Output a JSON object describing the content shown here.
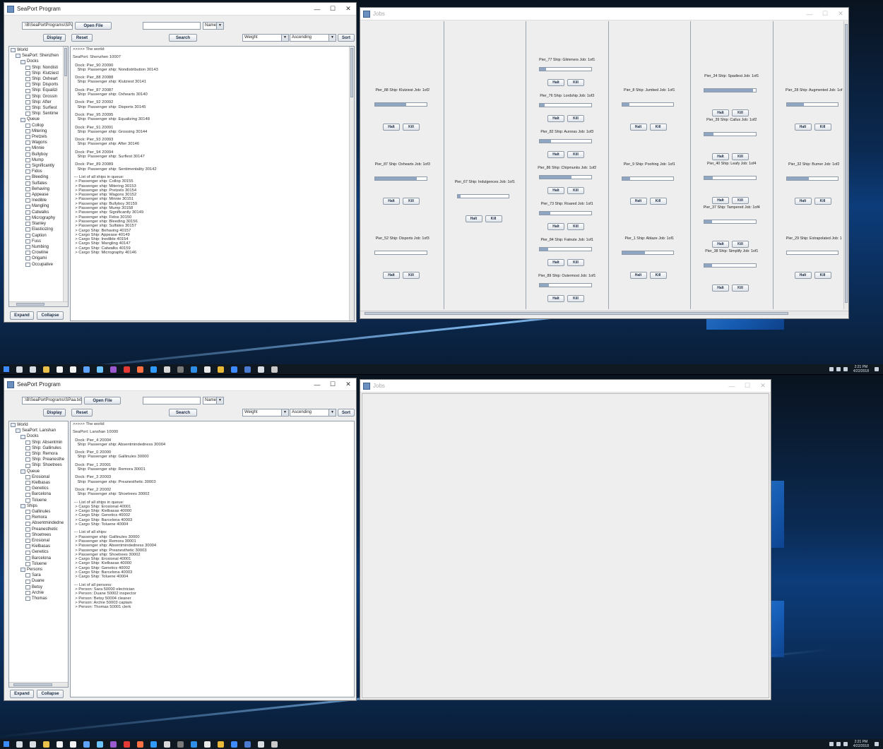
{
  "app": {
    "title": "SeaPort Program",
    "file_path": ":\\B\\SeaPortPrograms\\SPaa.txt",
    "open_file_label": "Open File",
    "search_value": "",
    "search_type": "Name",
    "display_label": "Display",
    "reset_label": "Reset",
    "search_label": "Search",
    "sort_field": "Weight",
    "sort_order": "Ascending",
    "sort_label": "Sort",
    "expand_label": "Expand",
    "collapse_label": "Collapse"
  },
  "jobs_window": {
    "title": "Jobs"
  },
  "window_buttons": {
    "minimize": "—",
    "maximize": "☐",
    "close": "✕"
  },
  "top": {
    "tree": [
      {
        "text": "World",
        "indent": 0,
        "folder": true
      },
      {
        "text": "SeaPort: Shenzhen",
        "indent": 1,
        "folder": true
      },
      {
        "text": "Docks",
        "indent": 2,
        "folder": true
      },
      {
        "text": "Ship: Nondisti",
        "indent": 3,
        "folder": false
      },
      {
        "text": "Ship: Klutziest",
        "indent": 3,
        "folder": false
      },
      {
        "text": "Ship: Oxheart",
        "indent": 3,
        "folder": false
      },
      {
        "text": "Ship: Disports",
        "indent": 3,
        "folder": false
      },
      {
        "text": "Ship: Equalizi",
        "indent": 3,
        "folder": false
      },
      {
        "text": "Ship: Grossin",
        "indent": 3,
        "folder": false
      },
      {
        "text": "Ship: After",
        "indent": 3,
        "folder": false
      },
      {
        "text": "Ship: Surfiest",
        "indent": 3,
        "folder": false
      },
      {
        "text": "Ship: Sentime",
        "indent": 3,
        "folder": false
      },
      {
        "text": "Queue",
        "indent": 2,
        "folder": true
      },
      {
        "text": "Collop",
        "indent": 3,
        "folder": false
      },
      {
        "text": "Mitering",
        "indent": 3,
        "folder": false
      },
      {
        "text": "Pretzels",
        "indent": 3,
        "folder": false
      },
      {
        "text": "Wagons",
        "indent": 3,
        "folder": false
      },
      {
        "text": "Minnie",
        "indent": 3,
        "folder": false
      },
      {
        "text": "Bullyboy",
        "indent": 3,
        "folder": false
      },
      {
        "text": "Mump",
        "indent": 3,
        "folder": false
      },
      {
        "text": "Significantly",
        "indent": 3,
        "folder": false
      },
      {
        "text": "Fidos",
        "indent": 3,
        "folder": false
      },
      {
        "text": "Bleeding",
        "indent": 3,
        "folder": false
      },
      {
        "text": "Sulfates",
        "indent": 3,
        "folder": false
      },
      {
        "text": "Behaving",
        "indent": 3,
        "folder": false
      },
      {
        "text": "Appease",
        "indent": 3,
        "folder": false
      },
      {
        "text": "Inedible",
        "indent": 3,
        "folder": false
      },
      {
        "text": "Mangling",
        "indent": 3,
        "folder": false
      },
      {
        "text": "Catwalks",
        "indent": 3,
        "folder": false
      },
      {
        "text": "Micrography",
        "indent": 3,
        "folder": false
      },
      {
        "text": "Stanley",
        "indent": 3,
        "folder": false
      },
      {
        "text": "Elasticizing",
        "indent": 3,
        "folder": false
      },
      {
        "text": "Caption",
        "indent": 3,
        "folder": false
      },
      {
        "text": "Fuss",
        "indent": 3,
        "folder": false
      },
      {
        "text": "Numbing",
        "indent": 3,
        "folder": false
      },
      {
        "text": "Crowline",
        "indent": 3,
        "folder": false
      },
      {
        "text": "Origami",
        "indent": 3,
        "folder": false
      },
      {
        "text": "Occupative",
        "indent": 3,
        "folder": false
      }
    ],
    "log": [
      ">>>>> The world:",
      "",
      "SeaPort: Shenzhen 10007",
      "",
      "  Dock: Pier_90 20090",
      "    Ship: Passenger ship: Nondistribution 30143",
      "",
      "  Dock: Pier_88 20088",
      "    Ship: Passenger ship: Klutziest 30141",
      "",
      "  Dock: Pier_87 20087",
      "    Ship: Passenger ship: Oxhearts 30140",
      "",
      "  Dock: Pier_92 20092",
      "    Ship: Passenger ship: Disports 30145",
      "",
      "  Dock: Pier_95 20095",
      "    Ship: Passenger ship: Equalizing 30148",
      "",
      "  Dock: Pier_91 20091",
      "    Ship: Passenger ship: Grossing 30144",
      "",
      "  Dock: Pier_93 20093",
      "    Ship: Passenger ship: After 30146",
      "",
      "  Dock: Pier_94 20094",
      "    Ship: Passenger ship: Surfiest 30147",
      "",
      "  Dock: Pier_89 20089",
      "    Ship: Passenger ship: Sentimentality 30142",
      "",
      " --- List of all ships in queue:",
      "  > Passenger ship: Collop 30155",
      "  > Passenger ship: Mitering 30153",
      "  > Passenger ship: Pretzels 30154",
      "  > Passenger ship: Wagons 30152",
      "  > Passenger ship: Minnie 30151",
      "  > Passenger ship: Bullyboy 30159",
      "  > Passenger ship: Mump 30158",
      "  > Passenger ship: Significantly 30149",
      "  > Passenger ship: Fidos 30150",
      "  > Passenger ship: Bleeding 30156",
      "  > Passenger ship: Sulfates 30157",
      "  > Cargo Ship: Behaving 40157",
      "  > Cargo Ship: Appease 40149",
      "  > Cargo Ship: Inedible 40154",
      "  > Cargo Ship: Mangling 40147",
      "  > Cargo Ship: Catwalks 40159",
      "  > Cargo Ship: Micrography 40146"
    ],
    "jobs": [
      [
        {
          "label": "Pier_88 Ship: Klutziest Job: 1of2",
          "progress": 0.6
        },
        {
          "label": "Pier_87 Ship: Oxhearts Job: 1of3",
          "progress": 0.82
        },
        {
          "label": "Pier_52 Ship: Disports Job: 1of3",
          "progress": 0
        }
      ],
      [
        {
          "label": "Pier_67 Ship: Indulgences Job: 1of1",
          "progress": 0.06
        }
      ],
      [
        {
          "label": "Pier_77 Ship: Glimmers Job: 1of1",
          "progress": 0.12
        },
        {
          "label": "Pier_76 Ship: Lordship Job: 1of3",
          "progress": 0.1
        },
        {
          "label": "Pier_82 Ship: Auroras Job: 1of3",
          "progress": 0.22
        },
        {
          "label": "Pier_86 Ship: Chipmunks Job: 1of2",
          "progress": 0.62
        },
        {
          "label": "Pier_73 Ship: Roared Job: 1of1",
          "progress": 0.2
        },
        {
          "label": "Pier_84 Ship: Fatnute Job: 1of1",
          "progress": 0.17
        },
        {
          "label": "Pier_89 Ship: Outermost Job: 1of1",
          "progress": 0.18
        }
      ],
      [
        {
          "label": "Pier_8 Ship: Jumbed Job: 1of1",
          "progress": 0.14
        },
        {
          "label": "Pier_9 Ship: Poohing Job: 1of1",
          "progress": 0.16
        },
        {
          "label": "Pier_1 Ship: Ablaze Job: 1of1",
          "progress": 0.45
        }
      ],
      [
        {
          "label": "Pier_34 Ship: Spadiest Job: 1of1",
          "progress": 0.95
        },
        {
          "label": "Pier_39 Ship: Callus Job: 1of2",
          "progress": 0.18
        },
        {
          "label": "Pier_40 Ship: Leafy Job: 1of4",
          "progress": 0.16
        },
        {
          "label": "Pier_37 Ship: Tampered Job: 1of4",
          "progress": 0.15
        },
        {
          "label": "Pier_38 Ship: Simplify Job: 1of1",
          "progress": 0.15
        }
      ],
      [
        {
          "label": "Pier_28 Ship: Augmented Job: 1of",
          "progress": 0.34
        },
        {
          "label": "Pier_32 Ship: Burner Job: 1of2",
          "progress": 0.43
        },
        {
          "label": "Pier_29 Ship: Extrapolated Job: 1",
          "progress": 0
        }
      ]
    ],
    "job_buttons": {
      "halt": "Halt",
      "kill": "Kill"
    },
    "clock_time": "2:21 PM",
    "clock_date": "4/22/2018"
  },
  "bottom": {
    "tree": [
      {
        "text": "World",
        "indent": 0,
        "folder": true
      },
      {
        "text": "SeaPort: Lanshan",
        "indent": 1,
        "folder": true
      },
      {
        "text": "Docks",
        "indent": 2,
        "folder": true
      },
      {
        "text": "Ship: Absentmin",
        "indent": 3,
        "folder": false
      },
      {
        "text": "Ship: Gallinules",
        "indent": 3,
        "folder": false
      },
      {
        "text": "Ship: Remora",
        "indent": 3,
        "folder": false
      },
      {
        "text": "Ship: Preanesthe",
        "indent": 3,
        "folder": false
      },
      {
        "text": "Ship: Shoetrees",
        "indent": 3,
        "folder": false
      },
      {
        "text": "Queue",
        "indent": 2,
        "folder": true
      },
      {
        "text": "Erosional",
        "indent": 3,
        "folder": false
      },
      {
        "text": "Kielbasas",
        "indent": 3,
        "folder": false
      },
      {
        "text": "Genetics",
        "indent": 3,
        "folder": false
      },
      {
        "text": "Barcelona",
        "indent": 3,
        "folder": false
      },
      {
        "text": "Toluene",
        "indent": 3,
        "folder": false
      },
      {
        "text": "Ships",
        "indent": 2,
        "folder": true
      },
      {
        "text": "Gallinules",
        "indent": 3,
        "folder": false
      },
      {
        "text": "Remora",
        "indent": 3,
        "folder": false
      },
      {
        "text": "Absentmindedne",
        "indent": 3,
        "folder": false
      },
      {
        "text": "Preanesthetic",
        "indent": 3,
        "folder": false
      },
      {
        "text": "Shoetrees",
        "indent": 3,
        "folder": false
      },
      {
        "text": "Erosional",
        "indent": 3,
        "folder": false
      },
      {
        "text": "Kielbasas",
        "indent": 3,
        "folder": false
      },
      {
        "text": "Genetics",
        "indent": 3,
        "folder": false
      },
      {
        "text": "Barcelona",
        "indent": 3,
        "folder": false
      },
      {
        "text": "Toluene",
        "indent": 3,
        "folder": false
      },
      {
        "text": "Persons",
        "indent": 2,
        "folder": true
      },
      {
        "text": "Sara",
        "indent": 3,
        "folder": false
      },
      {
        "text": "Duane",
        "indent": 3,
        "folder": false
      },
      {
        "text": "Betsy",
        "indent": 3,
        "folder": false
      },
      {
        "text": "Archie",
        "indent": 3,
        "folder": false
      },
      {
        "text": "Thomas",
        "indent": 3,
        "folder": false
      }
    ],
    "log": [
      ">>>>> The world:",
      "",
      "SeaPort: Lanshan 10000",
      "",
      "  Dock: Pier_4 20004",
      "    Ship: Passenger ship: Absentmindedness 30004",
      "",
      "  Dock: Pier_0 20000",
      "    Ship: Passenger ship: Gallinules 30000",
      "",
      "  Dock: Pier_1 20001",
      "    Ship: Passenger ship: Remora 30001",
      "",
      "  Dock: Pier_3 20003",
      "    Ship: Passenger ship: Preanesthetic 30003",
      "",
      "  Dock: Pier_2 20002",
      "    Ship: Passenger ship: Shoetrees 30002",
      "",
      " --- List of all ships in queue:",
      "  > Cargo Ship: Erosional 40001",
      "  > Cargo Ship: Kielbasas 40000",
      "  > Cargo Ship: Genetics 40002",
      "  > Cargo Ship: Barcelona 40003",
      "  > Cargo Ship: Toluene 40004",
      "",
      " --- List of all ships:",
      "  > Passenger ship: Gallinules 30000",
      "  > Passenger ship: Remora 30001",
      "  > Passenger ship: Absentmindedness 30004",
      "  > Passenger ship: Preanesthetic 30003",
      "  > Passenger ship: Shoetrees 30002",
      "  > Cargo Ship: Erosional 40001",
      "  > Cargo Ship: Kielbasas 40000",
      "  > Cargo Ship: Genetics 40002",
      "  > Cargo Ship: Barcelona 40003",
      "  > Cargo Ship: Toluene 40004",
      "",
      " --- List of all persons:",
      "  > Person: Sara 50000 electrician",
      "  > Person: Duane 50002 inspector",
      "  > Person: Betsy 50004 cleaner",
      "  > Person: Archie 50003 captain",
      "  > Person: Thomas 50001 clerk"
    ],
    "clock_time": "2:21 PM",
    "clock_date": "4/22/2018"
  },
  "taskbar_icons": [
    "start-icon",
    "search-icon",
    "task-view-icon",
    "file-explorer-icon",
    "store-icon",
    "mail-icon",
    "edge-icon",
    "photos-icon",
    "app-icon-1",
    "flash-icon",
    "app-icon-2",
    "chrome-icon",
    "app-icon-3",
    "app-icon-4",
    "vscode-icon",
    "app-icon-5",
    "chrome-icon-2",
    "app-icon-6",
    "app-icon-7",
    "java-icon",
    "java-app-icon"
  ],
  "colors": {
    "progress_fill": "#8ea6c2",
    "taskbar": "#101822"
  }
}
